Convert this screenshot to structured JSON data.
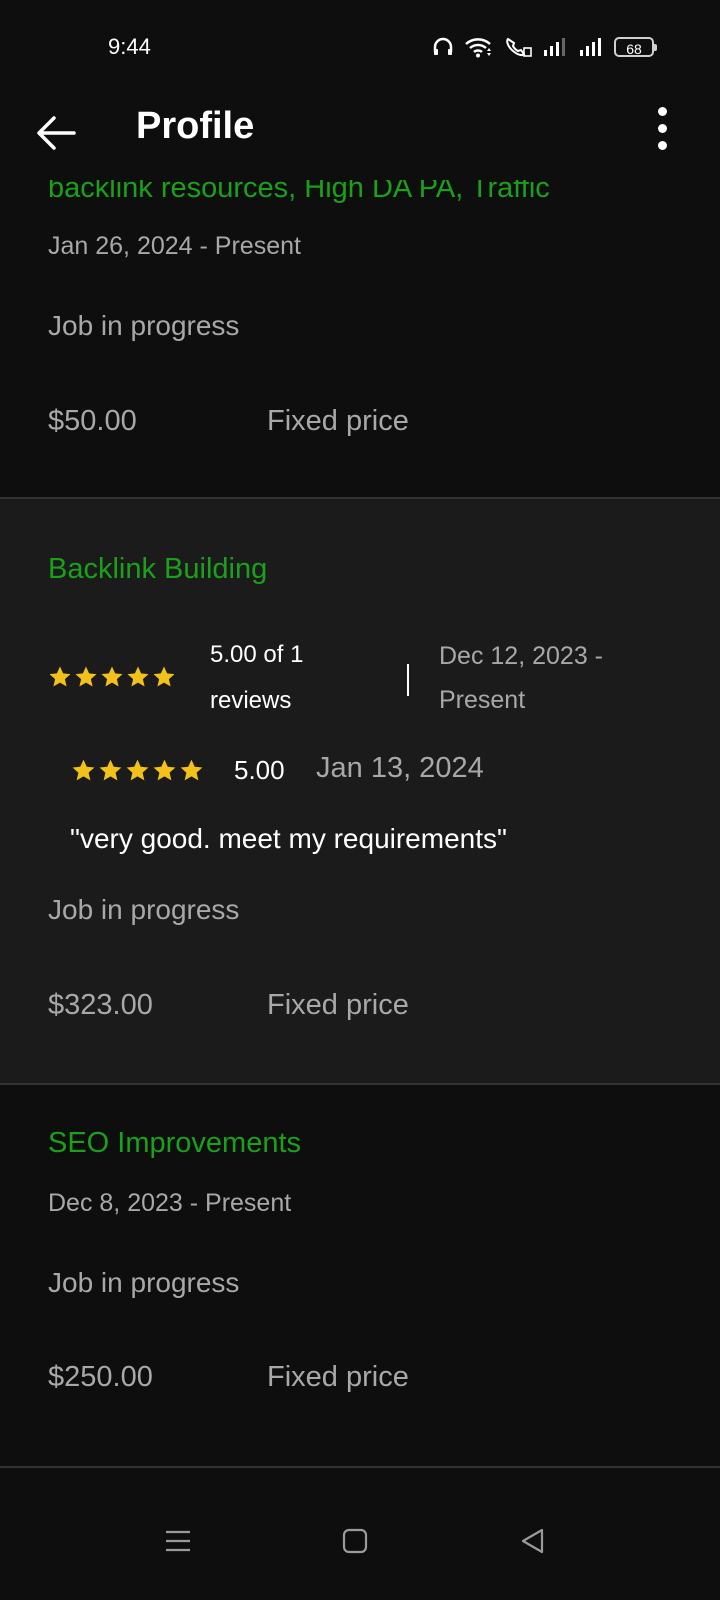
{
  "status_bar": {
    "time": "9:44",
    "battery": "68"
  },
  "header": {
    "title": "Profile"
  },
  "jobs": [
    {
      "title": "backlink resources, High DA PA, Traffic",
      "date_range": "Jan 26, 2024 - Present",
      "status": "Job in progress",
      "price": "$50.00",
      "price_type": "Fixed price"
    },
    {
      "title": "Backlink Building",
      "rating_summary_line1": "5.00 of 1",
      "rating_summary_line2": "reviews",
      "rating_stars": 5,
      "date_range_line1": "Dec 12, 2023 -",
      "date_range_line2": "Present",
      "review": {
        "score": "5.00",
        "stars": 5,
        "date": "Jan 13, 2024",
        "quote": "\"very good. meet my requirements\""
      },
      "status": "Job in progress",
      "price": "$323.00",
      "price_type": "Fixed price"
    },
    {
      "title": "SEO Improvements",
      "date_range": "Dec 8, 2023 - Present",
      "status": "Job in progress",
      "price": "$250.00",
      "price_type": "Fixed price"
    }
  ],
  "colors": {
    "accent": "#1aa01a",
    "star": "#f2c21b",
    "background": "#0e0e0e",
    "highlight_card": "#1b1b1b"
  },
  "icons": [
    "back-arrow-icon",
    "more-vertical-icon",
    "star-icon",
    "menu-icon",
    "home-square-icon",
    "back-triangle-icon"
  ]
}
